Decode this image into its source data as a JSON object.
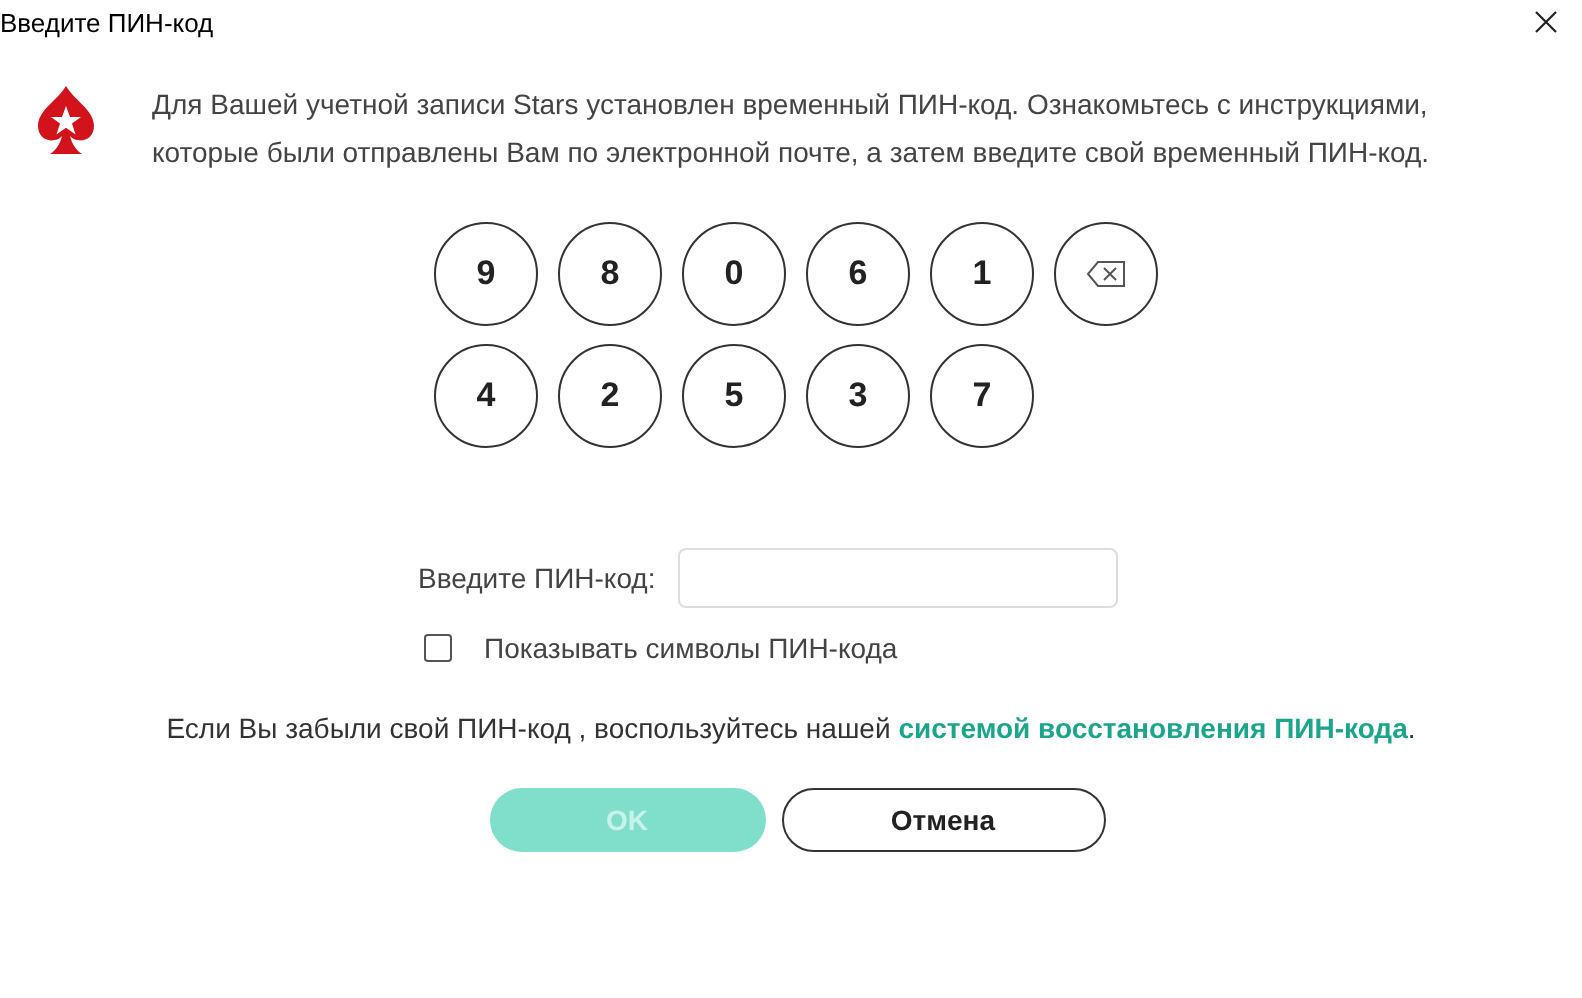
{
  "window": {
    "title": "Введите ПИН-код"
  },
  "message": "Для Вашей учетной записи Stars установлен временный ПИН-код. Ознакомьтесь с инструкциями, которые были отправлены Вам по электронной почте, а затем введите свой временный ПИН-код.",
  "keypad": {
    "rows": [
      [
        "9",
        "8",
        "0",
        "6",
        "1"
      ],
      [
        "4",
        "2",
        "5",
        "3",
        "7"
      ]
    ]
  },
  "pin_field": {
    "label": "Введите ПИН-код:"
  },
  "show_symbols": {
    "label": "Показывать символы ПИН-кода",
    "checked": false
  },
  "footer": {
    "text": "Если Вы забыли свой ПИН-код , воспользуйтесь нашей ",
    "link": "системой восстановления ПИН-кода",
    "end": "."
  },
  "buttons": [
    {
      "label": "OK",
      "disabled": true
    },
    {
      "label": "Отмена",
      "disabled": false
    }
  ]
}
